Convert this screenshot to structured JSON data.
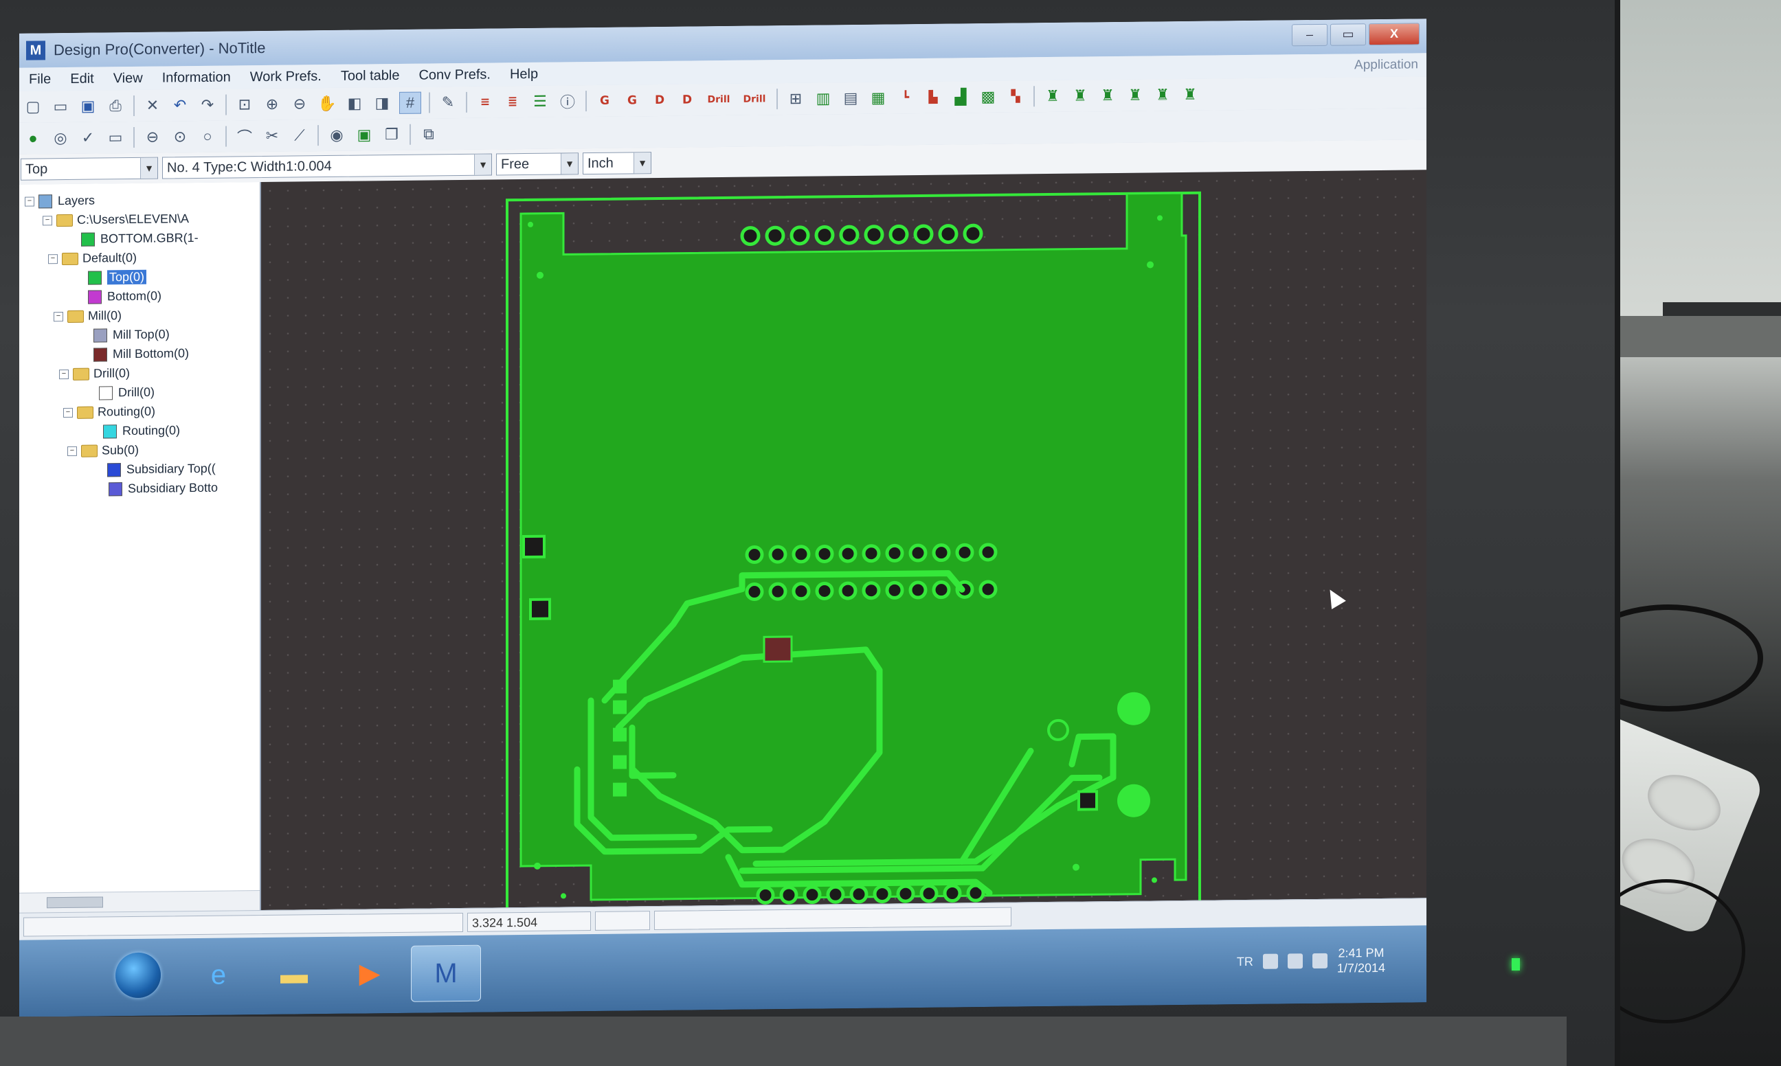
{
  "window": {
    "title": "Design Pro(Converter) - NoTitle",
    "app_label": "Application",
    "controls": [
      "–",
      "▭",
      "X"
    ]
  },
  "menu": [
    "File",
    "Edit",
    "View",
    "Information",
    "Work Prefs.",
    "Tool table",
    "Conv Prefs.",
    "Help"
  ],
  "toolbar": {
    "gerber_buttons": [
      "G",
      "G",
      "D",
      "D"
    ],
    "drill_buttons": [
      "Drill",
      "Drill"
    ]
  },
  "selectors": {
    "layer": "Top",
    "tool": "No.  4 Type:C Width1:0.004",
    "mode": "Free",
    "unit": "Inch"
  },
  "layers": {
    "root": "Layers",
    "file_folder": "C:\\Users\\ELEVEN\\A",
    "file_item": "BOTTOM.GBR(1-",
    "default_folder": "Default(0)",
    "top": "Top(0)",
    "bottom": "Bottom(0)",
    "mill_folder": "Mill(0)",
    "mill_top": "Mill Top(0)",
    "mill_bottom": "Mill Bottom(0)",
    "drill_folder": "Drill(0)",
    "drill": "Drill(0)",
    "routing_folder": "Routing(0)",
    "routing": "Routing(0)",
    "sub_folder": "Sub(0)",
    "sub_top": "Subsidiary Top((",
    "sub_bottom": "Subsidiary Botto"
  },
  "colors": {
    "pcb_green": "#22a81e",
    "trace_bright": "#35e83a",
    "canvas_bg": "#3a3536",
    "swatch_top": "#22c04a",
    "swatch_bottom": "#c23ad0",
    "swatch_mill_top": "#9aa0c0",
    "swatch_mill_bottom": "#7a2a2a",
    "swatch_drill": "#ffffff",
    "swatch_routing": "#35d6e0",
    "swatch_sub_top": "#2a4ad6",
    "swatch_sub_bottom": "#5a5ad6"
  },
  "status": {
    "coordinates": "3.324 1.504"
  },
  "taskbar": {
    "tray_lang": "TR",
    "time": "2:41 PM",
    "date": "1/7/2014",
    "icons": [
      "start-orb",
      "internet-explorer-icon",
      "folder-icon",
      "media-player-icon",
      "design-pro-icon"
    ]
  }
}
